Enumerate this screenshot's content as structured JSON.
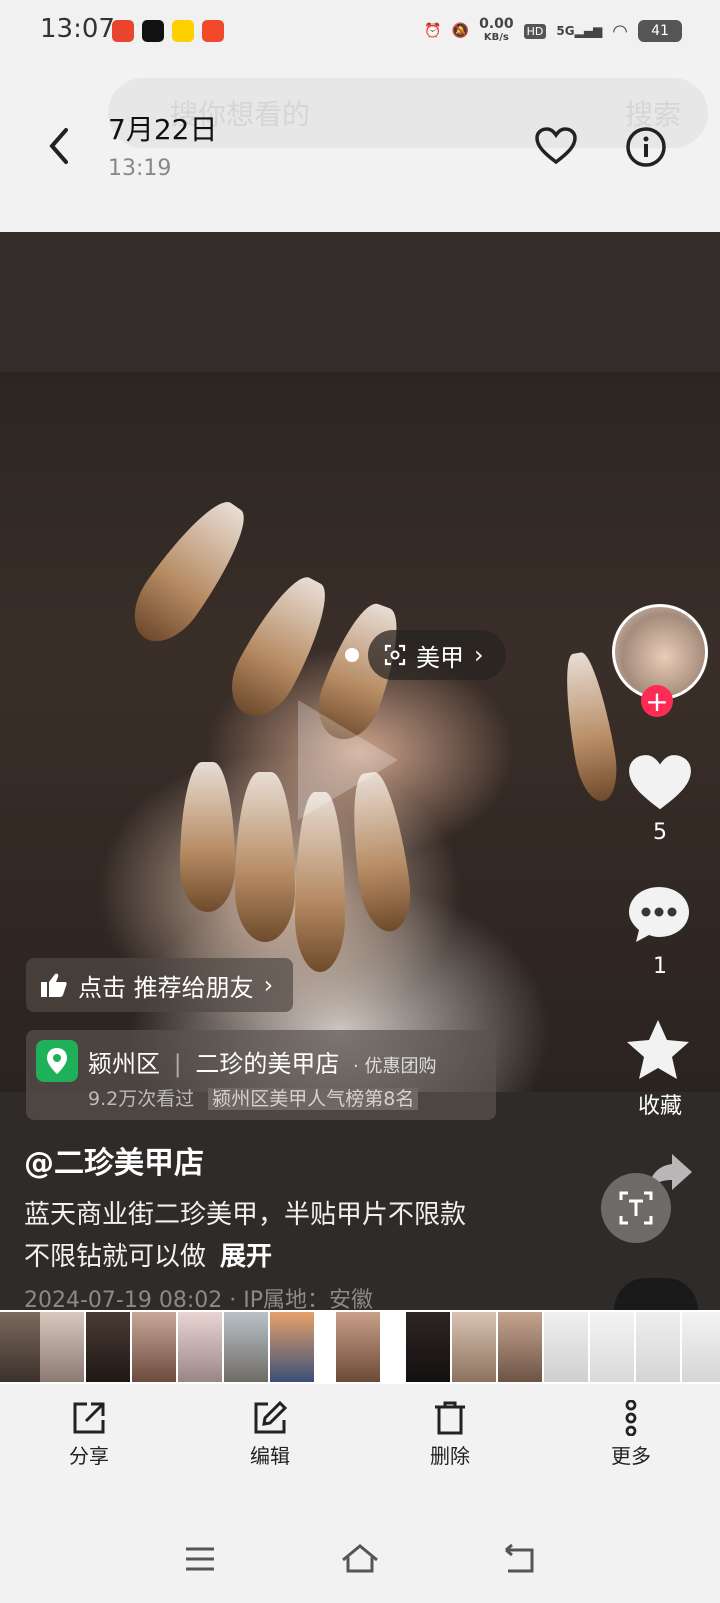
{
  "status_bar": {
    "time": "13:07",
    "net_speed": "0.00",
    "net_unit": "KB/s",
    "hd": "HD",
    "network": "5G",
    "battery": "41"
  },
  "header": {
    "search_placeholder": "搜你想看的",
    "search_button": "搜索",
    "date": "7月22日",
    "time": "13:19"
  },
  "video": {
    "tag": "美甲",
    "recommend": "点击 推荐给朋友",
    "poi": {
      "district": "颍州区",
      "shop": "二珍的美甲店",
      "extra": "· 优惠团购",
      "views": "9.2万次看过",
      "rank": "颍州区美甲人气榜第8名"
    },
    "author": "@二珍美甲店",
    "desc_line1": "蓝天商业街二珍美甲，半贴甲片不限款",
    "desc_line2": "不限钻就可以做",
    "expand": "展开",
    "meta": "2024-07-19 08:02 · IP属地：安徽"
  },
  "rail": {
    "likes": "5",
    "comments": "1",
    "favorite": "收藏"
  },
  "bottom_bar": {
    "share": "分享",
    "edit": "编辑",
    "delete": "删除",
    "more": "更多"
  },
  "colors": {
    "accent": "#fe2c55",
    "poi_green": "#1fb05a"
  }
}
